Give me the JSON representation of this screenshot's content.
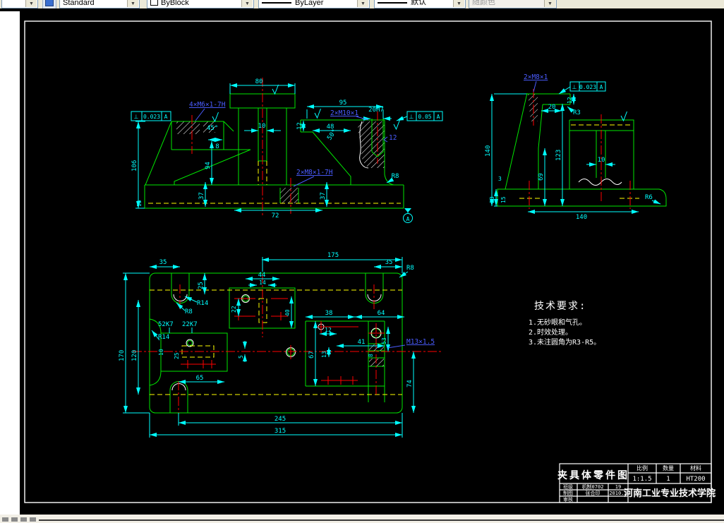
{
  "toolbar": {
    "style_value": "Standard",
    "color_value": "ByBlock",
    "linetype_value": "ByLayer",
    "lineweight_value": "默认",
    "plotstyle_value": "随颜色"
  },
  "front": {
    "thread_top": "4×M6×1-7H",
    "thread_mid": "2×M10×1",
    "thread_low": "2×M8×1-7H",
    "depth_note": "12",
    "gdt1_sym": "⊥",
    "gdt1_val": "0.023",
    "gdt1_ref": "A",
    "gdt2_sym": "⊥",
    "gdt2_val": "0.05",
    "gdt2_ref": "A",
    "datum": "A",
    "dims": {
      "w80": "80",
      "w10": "10",
      "a45": "45°",
      "d8": "8",
      "h94": "94",
      "h37l": "37",
      "h37r": "37",
      "w72": "72",
      "h106": "106",
      "h15": "15",
      "w95": "95",
      "h20h7": "20H7",
      "w48": "48",
      "a50": "50°",
      "r8": "R8",
      "h12": "12"
    }
  },
  "side": {
    "thread": "2×M8×1",
    "gdt_sym": "⊥",
    "gdt_val": "0.023",
    "gdt_ref": "A",
    "dims": {
      "h140": "140",
      "w20": "20",
      "h12": "12",
      "r3": "R3",
      "h123": "123",
      "h69": "69",
      "w10": "10",
      "d3": "3",
      "h23": "23",
      "h15": "15",
      "w140": "140",
      "r6": "R6"
    }
  },
  "plan": {
    "thread": "M13×1.5",
    "dims": {
      "w35l": "35",
      "h25": "25",
      "r14a": "R14",
      "r8a": "R8",
      "k52": "52K7",
      "k22": "22K7",
      "r14b": "R14",
      "h170": "170",
      "h120": "120",
      "w10": "10",
      "h25b": "25",
      "w65": "65",
      "w175": "175",
      "w35r": "35",
      "r8b": "R8",
      "w44": "44",
      "w14": "14",
      "h22": "22",
      "h40": "40",
      "w64": "64",
      "w38": "38",
      "w12": "12",
      "w41": "41",
      "h13": "13",
      "h67": "67",
      "h53": "53",
      "d8": "8",
      "h5": "5",
      "h74": "74",
      "w245": "245",
      "w315": "315"
    }
  },
  "tech": {
    "title": "技术要求:",
    "items": [
      "1.无砂眼和气孔。",
      "2.时效处理。",
      "3.未注圆角为R3-R5。"
    ]
  },
  "titleblock": {
    "drawing_title": "夹具体零件图",
    "scale_label": "比例",
    "scale": "1:1.5",
    "qty_label": "数量",
    "qty": "1",
    "material_label": "材料",
    "material": "HT200",
    "row1_label": "班级",
    "row1_value": "机制0702",
    "row1_extra": "19",
    "row2_label": "制图",
    "row2_value": "张合印",
    "row2_extra": "2010.2",
    "row3_label": "审核",
    "row3_value": "",
    "row3_extra": "",
    "school": "河南工业专业技术学院"
  }
}
